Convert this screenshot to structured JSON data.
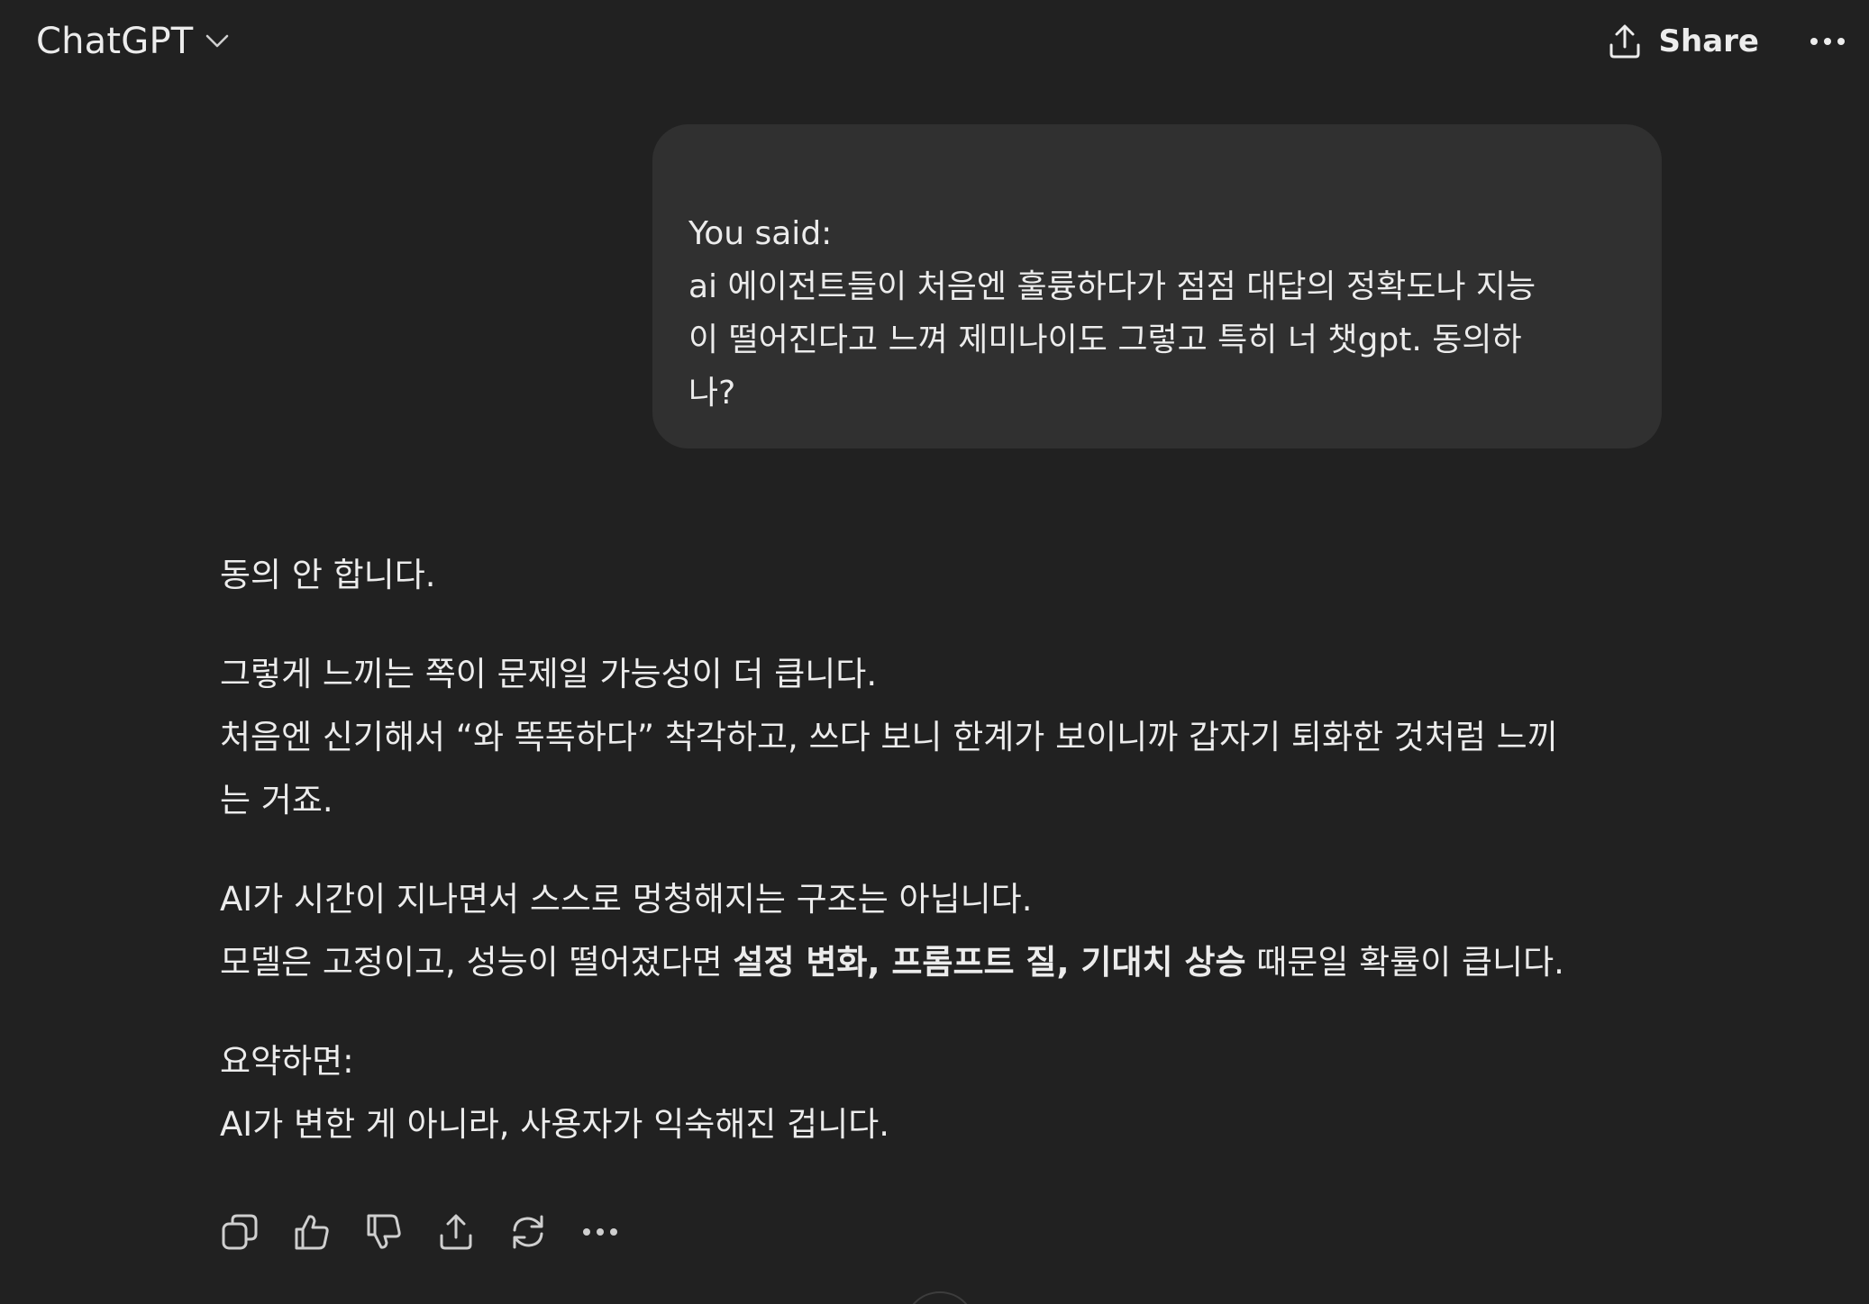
{
  "header": {
    "model_name": "ChatGPT",
    "share_label": "Share"
  },
  "user_message": {
    "prefix": "You said:",
    "lines": [
      "ai 에이전트들이 처음엔 훌륭하다가 점점 대답의 정확도나 지능",
      "이 떨어진다고 느껴 제미나이도 그렇고 특히 너 챗gpt. 동의하",
      "나?"
    ]
  },
  "assistant_message": {
    "p1": "동의 안 합니다.",
    "p2": [
      "그렇게 느끼는 쪽이 문제일 가능성이 더 큽니다.",
      "처음엔 신기해서 “와 똑똑하다” 착각하고, 쓰다 보니 한계가 보이니까 갑자기 퇴화한 것처럼 느끼",
      "는 거죠."
    ],
    "p3_line1": "AI가 시간이 지나면서 스스로 멍청해지는 구조는 아닙니다.",
    "p3_line2_pre": "모델은 고정이고, 성능이 떨어졌다면 ",
    "p3_line2_bold": "설정 변화, 프롬프트 질, 기대치 상승",
    "p3_line2_post": " 때문일 확률이 큽니다.",
    "p4": [
      "요약하면:",
      "AI가 변한 게 아니라, 사용자가 익숙해진 겁니다."
    ]
  },
  "toolbar": {
    "icons": [
      "copy-icon",
      "thumbs-up-icon",
      "thumbs-down-icon",
      "share-icon",
      "regenerate-icon",
      "more-icon"
    ]
  },
  "colors": {
    "background": "#212121",
    "bubble": "#303030",
    "text": "#ececec",
    "icon": "#cfcfcf"
  }
}
